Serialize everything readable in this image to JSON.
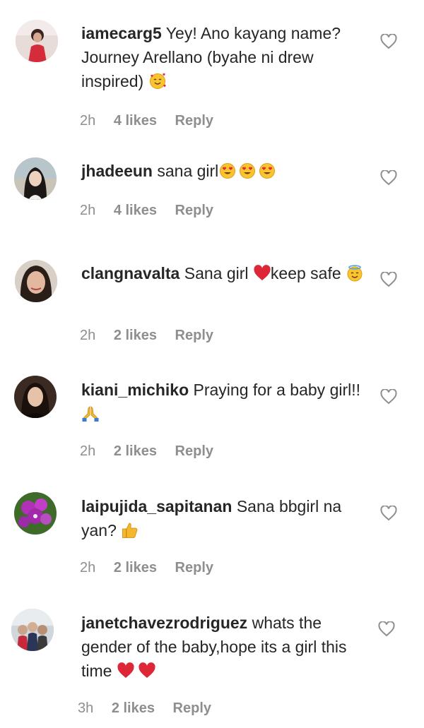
{
  "comments": [
    {
      "username": "iamecarg5",
      "text": "Yey! Ano kayang name? Journey Arellano (byahe ni drew inspired)",
      "emojis": [
        "smiling-hearts-face"
      ],
      "time": "2h",
      "likes": "4 likes",
      "reply": "Reply"
    },
    {
      "username": "jhadeeun",
      "text": "sana girl",
      "emojis": [
        "heart-eyes-face",
        "heart-eyes-face",
        "heart-eyes-face"
      ],
      "time": "2h",
      "likes": "4 likes",
      "reply": "Reply"
    },
    {
      "username": "clangnavalta",
      "text": "Sana girl",
      "text2": "keep safe",
      "emojis": [
        "red-heart",
        "smiling-halo-face"
      ],
      "time": "2h",
      "likes": "2 likes",
      "reply": "Reply"
    },
    {
      "username": "kiani_michiko",
      "text": "Praying for a baby girl!!",
      "emojis": [
        "folded-hands"
      ],
      "time": "2h",
      "likes": "2 likes",
      "reply": "Reply"
    },
    {
      "username": "laipujida_sapitanan",
      "text": "Sana bbgirl na yan?",
      "emojis": [
        "thumbs-up"
      ],
      "time": "2h",
      "likes": "2 likes",
      "reply": "Reply"
    },
    {
      "username": "janetchavezrodriguez",
      "text": "whats the gender of the baby,hope its a girl this time",
      "emojis": [
        "red-heart",
        "red-heart"
      ],
      "time": "3h",
      "likes": "2 likes",
      "reply": "Reply"
    }
  ],
  "colors": {
    "text": "#262626",
    "secondary": "#8e8e8e",
    "heart_outline": "#8e8e8e",
    "background": "#ffffff"
  },
  "icons": {
    "like": "heart-outline-icon"
  }
}
